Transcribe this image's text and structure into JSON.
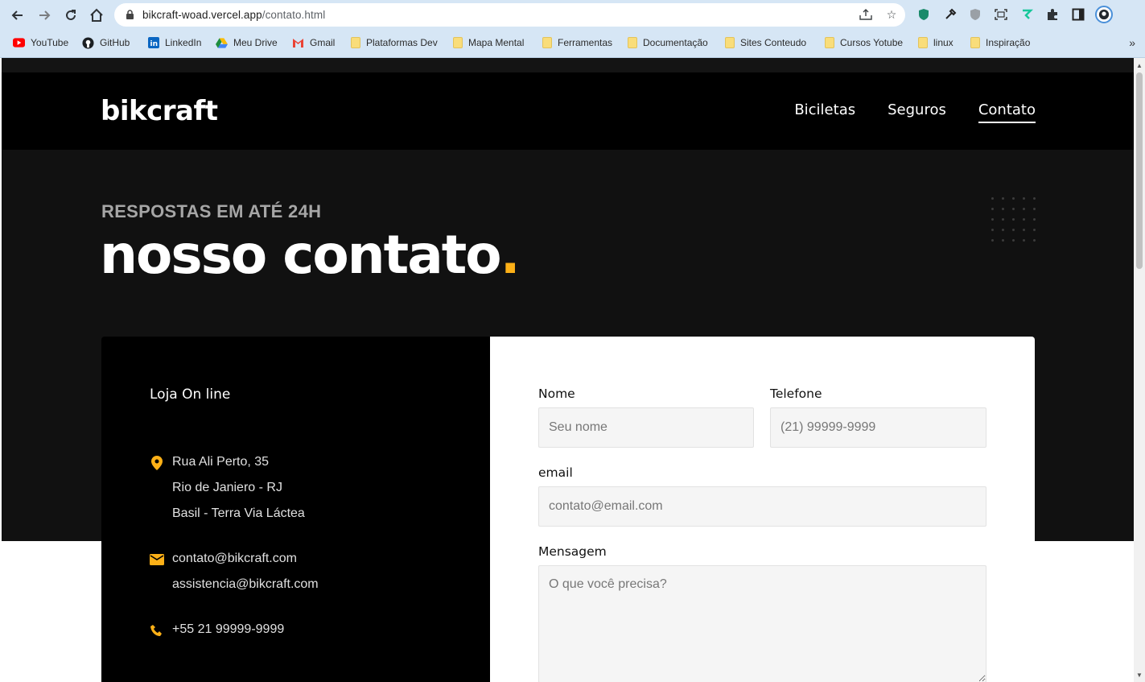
{
  "browser": {
    "url_host": "bikcraft-woad.vercel.app",
    "url_path": "/contato.html",
    "bookmarks": [
      {
        "label": "YouTube",
        "icon": "youtube-icon"
      },
      {
        "label": "GitHub",
        "icon": "github-icon"
      },
      {
        "label": "LinkedIn",
        "icon": "linkedin-icon"
      },
      {
        "label": "Meu Drive",
        "icon": "drive-icon"
      },
      {
        "label": "Gmail",
        "icon": "gmail-icon"
      },
      {
        "label": "Plataformas Dev",
        "icon": "folder-icon"
      },
      {
        "label": "Mapa Mental",
        "icon": "folder-icon"
      },
      {
        "label": "Ferramentas",
        "icon": "folder-icon"
      },
      {
        "label": "Documentação",
        "icon": "folder-icon"
      },
      {
        "label": "Sites Conteudo",
        "icon": "folder-icon"
      },
      {
        "label": "Cursos Yotube",
        "icon": "folder-icon"
      },
      {
        "label": "linux",
        "icon": "folder-icon"
      },
      {
        "label": "Inspiração",
        "icon": "folder-icon"
      }
    ]
  },
  "header": {
    "logo": "bikcraft",
    "nav": [
      "Biciletas",
      "Seguros",
      "Contato"
    ],
    "active_nav": "Contato"
  },
  "hero": {
    "subtitle": "RESPOSTAS EM ATÉ 24H",
    "title": "nosso contato",
    "title_dot": ".",
    "accent_color": "#fcb017"
  },
  "contact_info": {
    "store": "Loja On line",
    "address": [
      "Rua Ali Perto, 35",
      "Rio de Janiero - RJ",
      "Basil - Terra Via Láctea"
    ],
    "emails": [
      "contato@bikcraft.com",
      "assistencia@bikcraft.com"
    ],
    "phone": "+55 21 99999-9999"
  },
  "form": {
    "name_label": "Nome",
    "name_placeholder": "Seu nome",
    "phone_label": "Telefone",
    "phone_placeholder": "(21) 99999-9999",
    "email_label": "email",
    "email_placeholder": "contato@email.com",
    "message_label": "Mensagem",
    "message_placeholder": "O que você precisa?"
  }
}
